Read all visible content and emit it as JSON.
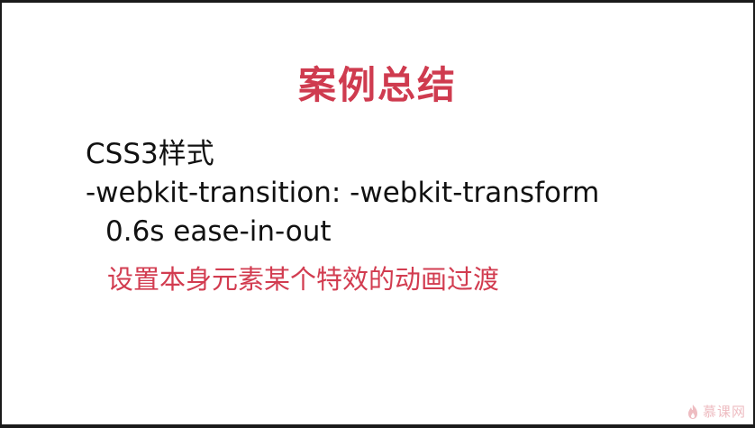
{
  "slide": {
    "title": "案例总结",
    "lines": [
      "CSS3样式",
      "-webkit-transition: -webkit-transform",
      "0.6s ease-in-out",
      "设置本身元素某个特效的动画过渡"
    ],
    "watermark": {
      "icon": "flame-logo-icon",
      "text": "慕课网"
    },
    "colors": {
      "accent": "#cf3b4f",
      "text": "#111111",
      "background": "#ffffff",
      "frame": "#1a1a1a"
    }
  }
}
